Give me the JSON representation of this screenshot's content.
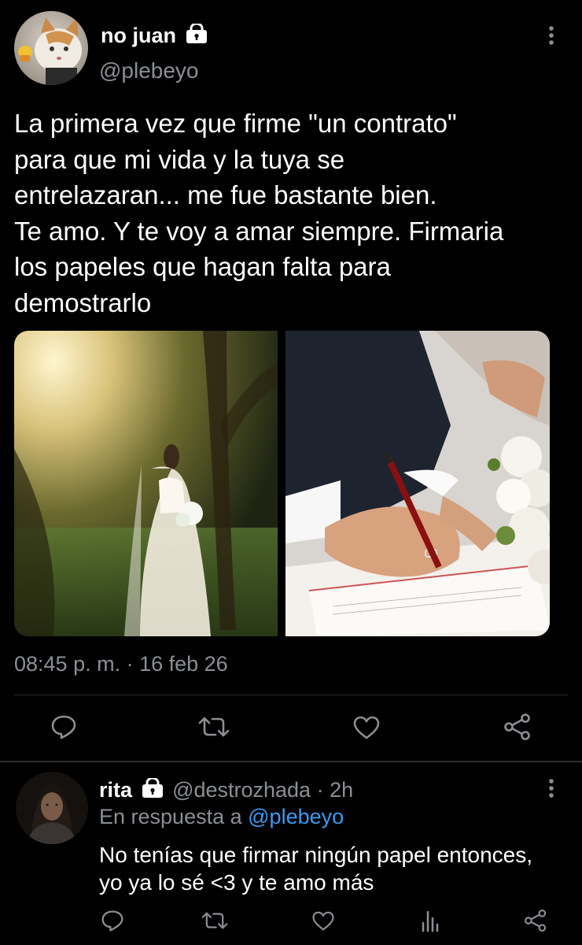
{
  "tweet": {
    "display_name": "no juan",
    "handle": "@plebeyo",
    "text_lines": [
      "La primera vez que firme \"un contrato\"",
      "para que mi vida y la tuya se",
      "entrelazaran... me fue bastante bien.",
      "Te amo. Y te voy a amar siempre. Firmaria",
      "los papeles que hagan falta para",
      "demostrarlo"
    ],
    "timestamp": "08:45 p. m. · 16 feb 26",
    "images": [
      {
        "name": "bride-photo",
        "icon": "photo"
      },
      {
        "name": "signing-photo",
        "icon": "photo"
      }
    ]
  },
  "reply": {
    "display_name": "rita",
    "handle": "@destrozhada",
    "time": "· 2h",
    "in_reply_prefix": "En respuesta a",
    "in_reply_handle": "@plebeyo",
    "text_lines": [
      "No tenías que firmar ningún papel entonces,",
      "yo ya lo sé <3 y te amo más"
    ]
  },
  "icons": {
    "reply": "comment-icon",
    "retweet": "retweet-icon",
    "like": "heart-icon",
    "share": "share-icon",
    "analytics": "analytics-icon",
    "more": "more-vertical-icon",
    "lock": "lock-icon"
  },
  "colors": {
    "background": "#000000",
    "text": "#e7e9ea",
    "secondary": "#8b8f94",
    "accent": "#3b9bf0"
  }
}
